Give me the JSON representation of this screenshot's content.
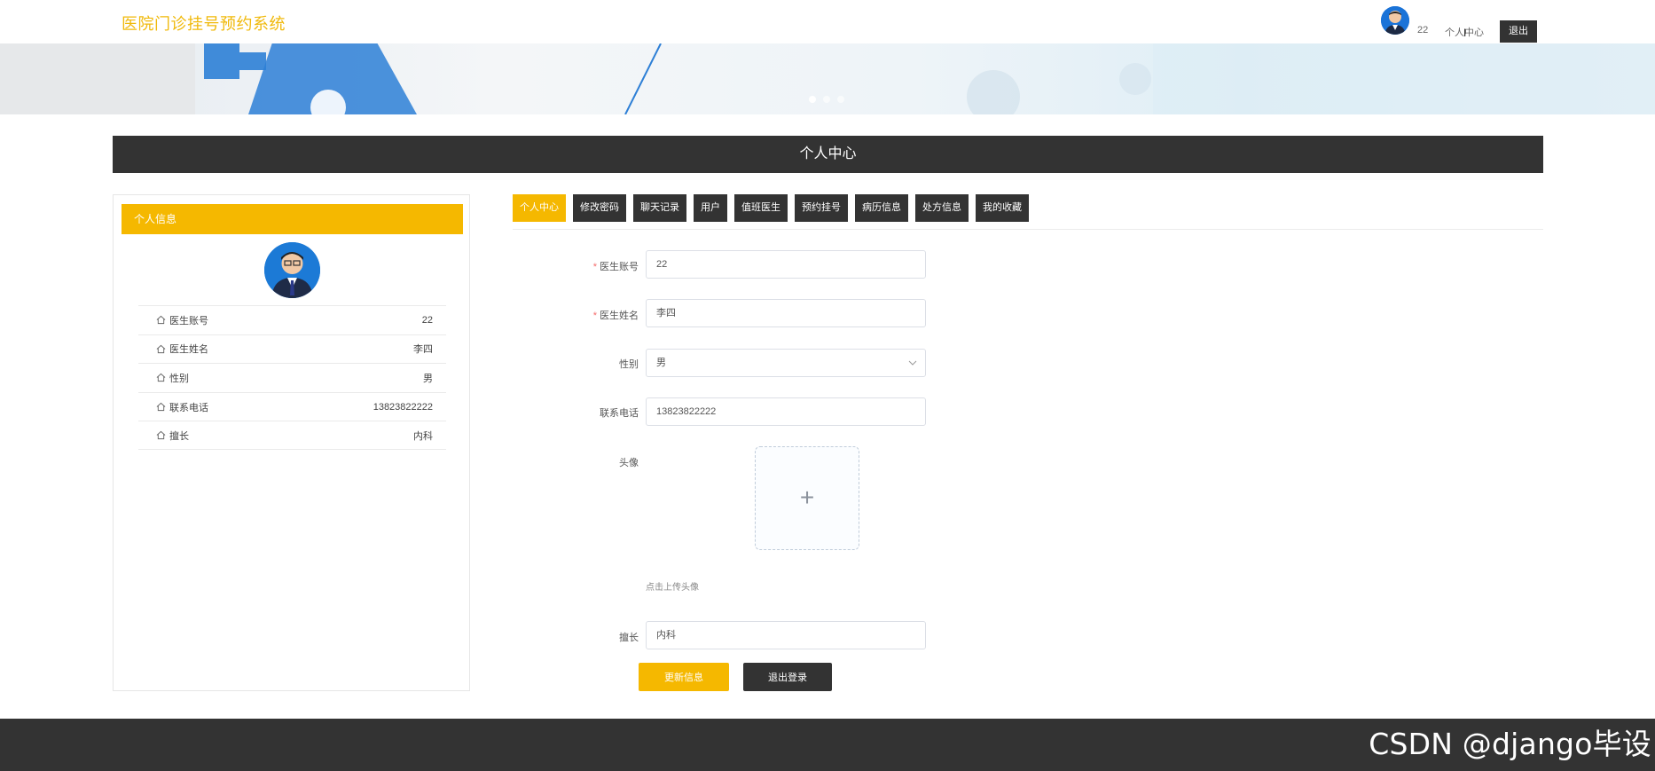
{
  "header": {
    "site_title": "医院门诊挂号预约系统",
    "username": "22",
    "center_link": "个人中心",
    "cursor_glyph": "I",
    "logout_label": "退出"
  },
  "banner": {
    "slides": 3,
    "active_slide": 1
  },
  "section_title": "个人中心",
  "left_panel": {
    "title": "个人信息",
    "rows": [
      {
        "label": "医生账号",
        "value": "22"
      },
      {
        "label": "医生姓名",
        "value": "李四"
      },
      {
        "label": "性别",
        "value": "男"
      },
      {
        "label": "联系电话",
        "value": "13823822222"
      },
      {
        "label": "擅长",
        "value": "内科"
      }
    ]
  },
  "tabs": [
    {
      "label": "个人中心",
      "active": true
    },
    {
      "label": "修改密码",
      "active": false
    },
    {
      "label": "聊天记录",
      "active": false
    },
    {
      "label": "用户",
      "active": false
    },
    {
      "label": "值班医生",
      "active": false
    },
    {
      "label": "预约挂号",
      "active": false
    },
    {
      "label": "病历信息",
      "active": false
    },
    {
      "label": "处方信息",
      "active": false
    },
    {
      "label": "我的收藏",
      "active": false
    }
  ],
  "form": {
    "account_label": "医生账号",
    "account_value": "22",
    "name_label": "医生姓名",
    "name_value": "李四",
    "gender_label": "性别",
    "gender_value": "男",
    "phone_label": "联系电话",
    "phone_value": "13823822222",
    "avatar_label": "头像",
    "upload_plus": "+",
    "upload_tip": "点击上传头像",
    "specialty_label": "擅长",
    "specialty_value": "内科",
    "required_mark": "*"
  },
  "buttons": {
    "update": "更新信息",
    "logout": "退出登录"
  },
  "watermark": "CSDN @django毕设",
  "colors": {
    "accent": "#f5b800",
    "title": "#f0b90b",
    "dark": "#333333"
  }
}
